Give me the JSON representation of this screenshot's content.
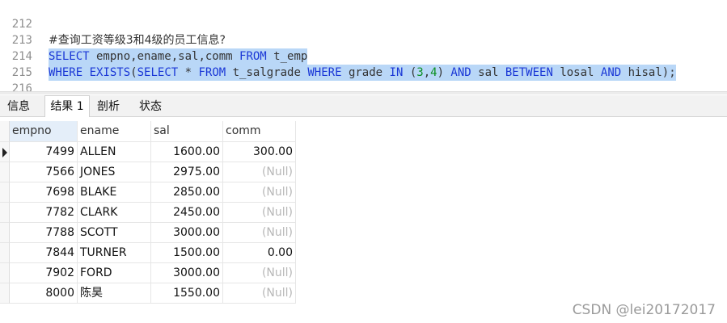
{
  "editor": {
    "lines": [
      {
        "no": "212",
        "comment": "#查询工资等级3和4级的员工信息?"
      },
      {
        "no": "213",
        "tokens": [
          "SELECT",
          " empno,ename,sal,comm ",
          "FROM",
          " t_emp"
        ]
      },
      {
        "no": "214",
        "tokens": [
          "WHERE",
          " ",
          "EXISTS",
          "(",
          "SELECT",
          " * ",
          "FROM",
          " t_salgrade ",
          "WHERE",
          " grade ",
          "IN",
          " (",
          "3",
          ",",
          "4",
          ") ",
          "AND",
          " sal ",
          "BETWEEN",
          " losal ",
          "AND",
          " hisal);"
        ]
      },
      {
        "no": "215"
      },
      {
        "no": "216"
      }
    ]
  },
  "tabs": [
    "信息",
    "结果 1",
    "剖析",
    "状态"
  ],
  "active_tab": "结果 1",
  "grid": {
    "columns": [
      "empno",
      "ename",
      "sal",
      "comm"
    ],
    "rows": [
      [
        "7499",
        "ALLEN",
        "1600.00",
        "300.00"
      ],
      [
        "7566",
        "JONES",
        "2975.00",
        "(Null)"
      ],
      [
        "7698",
        "BLAKE",
        "2850.00",
        "(Null)"
      ],
      [
        "7782",
        "CLARK",
        "2450.00",
        "(Null)"
      ],
      [
        "7788",
        "SCOTT",
        "3000.00",
        "(Null)"
      ],
      [
        "7844",
        "TURNER",
        "1500.00",
        "0.00"
      ],
      [
        "7902",
        "FORD",
        "3000.00",
        "(Null)"
      ],
      [
        "8000",
        "陈昊",
        "1550.00",
        "(Null)"
      ]
    ]
  },
  "watermark": "CSDN @lei20172017",
  "colors": {
    "keyword": "#1a37d6",
    "number": "#0a8f21",
    "selection": "#b9d7f7",
    "null": "#b7b7b7"
  }
}
